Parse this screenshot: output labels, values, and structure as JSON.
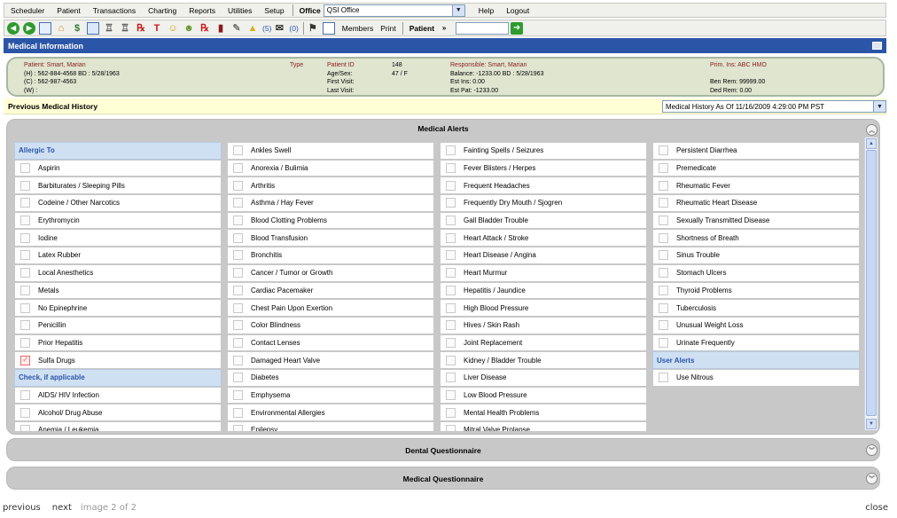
{
  "menu": {
    "items": [
      "Scheduler",
      "Patient",
      "Transactions",
      "Charting",
      "Reports",
      "Utilities",
      "Setup"
    ],
    "office_label": "Office",
    "office_value": "QSI Office",
    "help": "Help",
    "logout": "Logout"
  },
  "toolbar": {
    "counter1": "(5)",
    "counter2": "(0)",
    "members": "Members",
    "print": "Print",
    "patient": "Patient"
  },
  "header": {
    "title": "Medical Information"
  },
  "patient": {
    "name_line": "Patient: Smart, Marian",
    "home": "(H) : 562-884-4568   BD : 5/28/1963",
    "cell": "(C) : 562-987-4563",
    "work": "(W) :",
    "type_label": "Type",
    "id_label": "Patient ID",
    "id_value": "148",
    "age_label": "Age/Sex:",
    "age_value": "47 / F",
    "first_visit_label": "First Visit:",
    "last_visit_label": "Last Visit:",
    "responsible": "Responsible: Smart, Marian",
    "balance": "Balance: -1233.00   BD : 5/28/1963",
    "est_ins": "Est Ins:  0.00",
    "est_pat": "Est Pat: -1233.00",
    "prim_ins": "Prim. Ins: ABC HMO",
    "ben_rem": "Ben Rem:  99999.00",
    "ded_rem": "Ded Rem:  0.00"
  },
  "pmh": {
    "title": "Previous Medical History",
    "select_value": "Medical History As Of 11/16/2009 4:29:00 PM PST"
  },
  "alerts_panel": {
    "title": "Medical Alerts"
  },
  "columns": [
    {
      "rows": [
        {
          "header": "Allergic To"
        },
        {
          "label": "Aspirin",
          "checked": false
        },
        {
          "label": "Barbiturates /  Sleeping Pills",
          "checked": false
        },
        {
          "label": "Codeine /  Other Narcotics",
          "checked": false
        },
        {
          "label": "Erythromycin",
          "checked": false
        },
        {
          "label": "Iodine",
          "checked": false
        },
        {
          "label": "Latex Rubber",
          "checked": false
        },
        {
          "label": "Local Anesthetics",
          "checked": false
        },
        {
          "label": "Metals",
          "checked": false
        },
        {
          "label": "No Epinephrine",
          "checked": false
        },
        {
          "label": "Penicillin",
          "checked": false
        },
        {
          "label": "Prior Hepatitis",
          "checked": false
        },
        {
          "label": "Sulfa Drugs",
          "checked": true
        },
        {
          "header": "Check, if applicable"
        },
        {
          "label": "AIDS/ HIV Infection",
          "checked": false
        },
        {
          "label": "Alcohol/ Drug Abuse",
          "checked": false
        },
        {
          "label": "Anemia /  Leukemia",
          "checked": false
        }
      ]
    },
    {
      "rows": [
        {
          "label": "Ankles Swell",
          "checked": false
        },
        {
          "label": "Anorexia /  Bulimia",
          "checked": false
        },
        {
          "label": "Arthritis",
          "checked": false
        },
        {
          "label": "Asthma /  Hay Fever",
          "checked": false
        },
        {
          "label": "Blood Clotting Problems",
          "checked": false
        },
        {
          "label": "Blood Transfusion",
          "checked": false
        },
        {
          "label": "Bronchitis",
          "checked": false
        },
        {
          "label": "Cancer /  Tumor or Growth",
          "checked": false
        },
        {
          "label": "Cardiac Pacemaker",
          "checked": false
        },
        {
          "label": "Chest Pain Upon Exertion",
          "checked": false
        },
        {
          "label": "Color Blindness",
          "checked": false
        },
        {
          "label": "Contact Lenses",
          "checked": false
        },
        {
          "label": "Damaged Heart Valve",
          "checked": false
        },
        {
          "label": "Diabetes",
          "checked": false
        },
        {
          "label": "Emphysema",
          "checked": false
        },
        {
          "label": "Environmental Allergies",
          "checked": false
        },
        {
          "label": "Epilepsy",
          "checked": false
        }
      ]
    },
    {
      "rows": [
        {
          "label": "Fainting Spells /  Seizures",
          "checked": false
        },
        {
          "label": "Fever Blisters /  Herpes",
          "checked": false
        },
        {
          "label": "Frequent Headaches",
          "checked": false
        },
        {
          "label": "Frequently Dry Mouth /  Sjogren",
          "checked": false
        },
        {
          "label": "Gall Bladder Trouble",
          "checked": false
        },
        {
          "label": "Heart Attack /  Stroke",
          "checked": false
        },
        {
          "label": "Heart Disease /  Angina",
          "checked": false
        },
        {
          "label": "Heart Murmur",
          "checked": false
        },
        {
          "label": "Hepatitis /  Jaundice",
          "checked": false
        },
        {
          "label": "High Blood Pressure",
          "checked": false
        },
        {
          "label": "Hives /  Skin Rash",
          "checked": false
        },
        {
          "label": "Joint Replacement",
          "checked": false
        },
        {
          "label": "Kidney /  Bladder Trouble",
          "checked": false
        },
        {
          "label": "Liver Disease",
          "checked": false
        },
        {
          "label": "Low Blood Pressure",
          "checked": false
        },
        {
          "label": "Mental Health Problems",
          "checked": false
        },
        {
          "label": "Mitral Valve Prolapse",
          "checked": false
        }
      ]
    },
    {
      "rows": [
        {
          "label": "Persistent Diarrhea",
          "checked": false
        },
        {
          "label": "Premedicate",
          "checked": false
        },
        {
          "label": "Rheumatic Fever",
          "checked": false
        },
        {
          "label": "Rheumatic Heart Disease",
          "checked": false
        },
        {
          "label": "Sexually Transmitted Disease",
          "checked": false
        },
        {
          "label": "Shortness of Breath",
          "checked": false
        },
        {
          "label": "Sinus Trouble",
          "checked": false
        },
        {
          "label": "Stomach Ulcers",
          "checked": false
        },
        {
          "label": "Thyroid Problems",
          "checked": false
        },
        {
          "label": "Tuberculosis",
          "checked": false
        },
        {
          "label": "Unusual Weight Loss",
          "checked": false
        },
        {
          "label": "Urinate Frequently",
          "checked": false
        },
        {
          "header": "User Alerts"
        },
        {
          "label": "Use Nitrous",
          "checked": false
        }
      ]
    }
  ],
  "dental_panel": {
    "title": "Dental Questionnaire"
  },
  "medical_q_panel": {
    "title": "Medical Questionnaire"
  },
  "footer": {
    "previous": "previous",
    "next": "next",
    "image_count": "image 2 of 2",
    "close": "close"
  },
  "colors": {
    "header_blue": "#2b55a7",
    "checked_red": "#e07070",
    "patient_box": "#dfe5cf"
  }
}
